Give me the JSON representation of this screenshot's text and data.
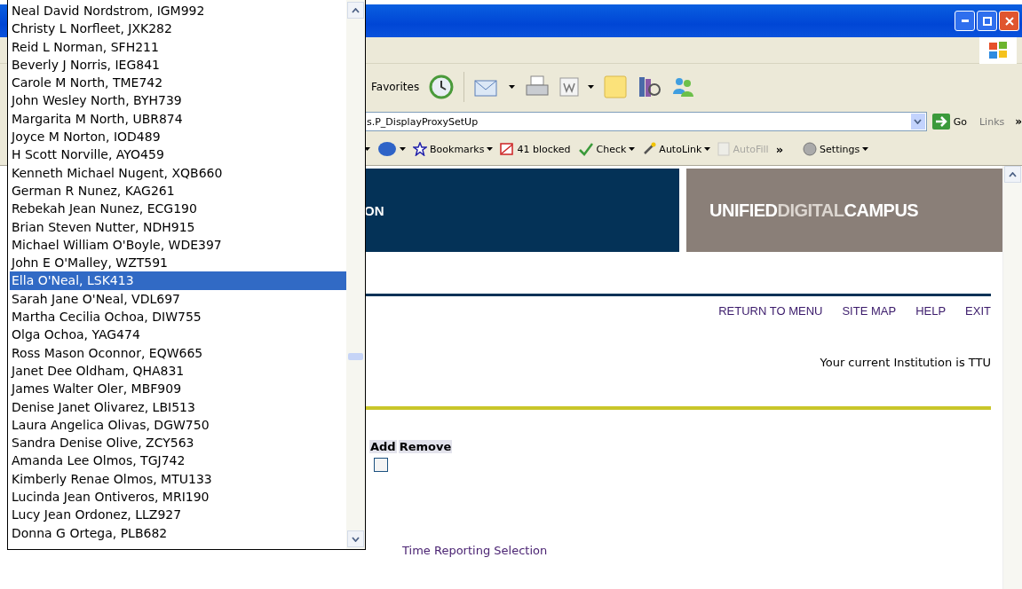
{
  "toolbar": {
    "favorites_label": "Favorites"
  },
  "address_bar": {
    "value": "s.P_DisplayProxySetUp",
    "go_label": "Go",
    "links_label": "Links",
    "more": "»"
  },
  "links_toolbar": {
    "items": [
      {
        "kind": "dropdown",
        "disabled": false
      },
      {
        "kind": "dropdown",
        "disabled": false
      },
      {
        "kind": "menu",
        "label": "Bookmarks",
        "disabled": false
      },
      {
        "kind": "plain",
        "label": "41 blocked",
        "disabled": false
      },
      {
        "kind": "menu",
        "label": "Check",
        "disabled": false
      },
      {
        "kind": "menu",
        "label": "AutoLink",
        "disabled": false
      },
      {
        "kind": "plain",
        "label": "AutoFill",
        "disabled": true
      },
      {
        "kind": "chevron",
        "label": "»",
        "disabled": false
      },
      {
        "kind": "menu",
        "label": "Settings",
        "disabled": false
      }
    ]
  },
  "header": {
    "title_fragment": "ON",
    "logo": [
      {
        "text": "UNIFIED",
        "color": "#ffffff"
      },
      {
        "text": "DIGITAL",
        "color": "#dcd6d0"
      },
      {
        "text": "CAMPUS",
        "color": "#ffffff"
      }
    ]
  },
  "nav_links": [
    "RETURN TO MENU",
    "SITE MAP",
    "HELP",
    "EXIT"
  ],
  "institution_text": "Your current Institution is TTU",
  "proxy_table": {
    "columns": [
      "Add",
      "Remove"
    ],
    "rows": [
      {
        "checked": false
      }
    ]
  },
  "footer_link": "Time Reporting Selection",
  "dropdown": {
    "options": [
      {
        "label": "Neal David Nordstrom, IGM992",
        "selected": false
      },
      {
        "label": "Christy L Norfleet, JXK282",
        "selected": false
      },
      {
        "label": "Reid L Norman, SFH211",
        "selected": false
      },
      {
        "label": "Beverly J Norris, IEG841",
        "selected": false
      },
      {
        "label": "Carole M North, TME742",
        "selected": false
      },
      {
        "label": "John Wesley North, BYH739",
        "selected": false
      },
      {
        "label": "Margarita M North, UBR874",
        "selected": false
      },
      {
        "label": "Joyce M Norton, IOD489",
        "selected": false
      },
      {
        "label": "H Scott Norville, AYO459",
        "selected": false
      },
      {
        "label": "Kenneth Michael Nugent, XQB660",
        "selected": false
      },
      {
        "label": "German R Nunez, KAG261",
        "selected": false
      },
      {
        "label": "Rebekah Jean Nunez, ECG190",
        "selected": false
      },
      {
        "label": "Brian Steven Nutter, NDH915",
        "selected": false
      },
      {
        "label": "Michael William O'Boyle, WDE397",
        "selected": false
      },
      {
        "label": "John E O'Malley, WZT591",
        "selected": false
      },
      {
        "label": "Ella O'Neal, LSK413",
        "selected": true
      },
      {
        "label": "Sarah Jane O'Neal, VDL697",
        "selected": false
      },
      {
        "label": "Martha Cecilia Ochoa, DIW755",
        "selected": false
      },
      {
        "label": "Olga Ochoa, YAG474",
        "selected": false
      },
      {
        "label": "Ross Mason Oconnor, EQW665",
        "selected": false
      },
      {
        "label": "Janet Dee Oldham, QHA831",
        "selected": false
      },
      {
        "label": "James Walter Oler, MBF909",
        "selected": false
      },
      {
        "label": "Denise Janet Olivarez, LBI513",
        "selected": false
      },
      {
        "label": "Laura Angelica Olivas, DGW750",
        "selected": false
      },
      {
        "label": "Sandra Denise Olive, ZCY563",
        "selected": false
      },
      {
        "label": "Amanda Lee Olmos, TGJ742",
        "selected": false
      },
      {
        "label": "Kimberly Renae Olmos, MTU133",
        "selected": false
      },
      {
        "label": "Lucinda Jean Ontiveros, MRI190",
        "selected": false
      },
      {
        "label": "Lucy Jean Ordonez, LLZ927",
        "selected": false
      },
      {
        "label": "Donna G Ortega, PLB682",
        "selected": false
      }
    ]
  }
}
